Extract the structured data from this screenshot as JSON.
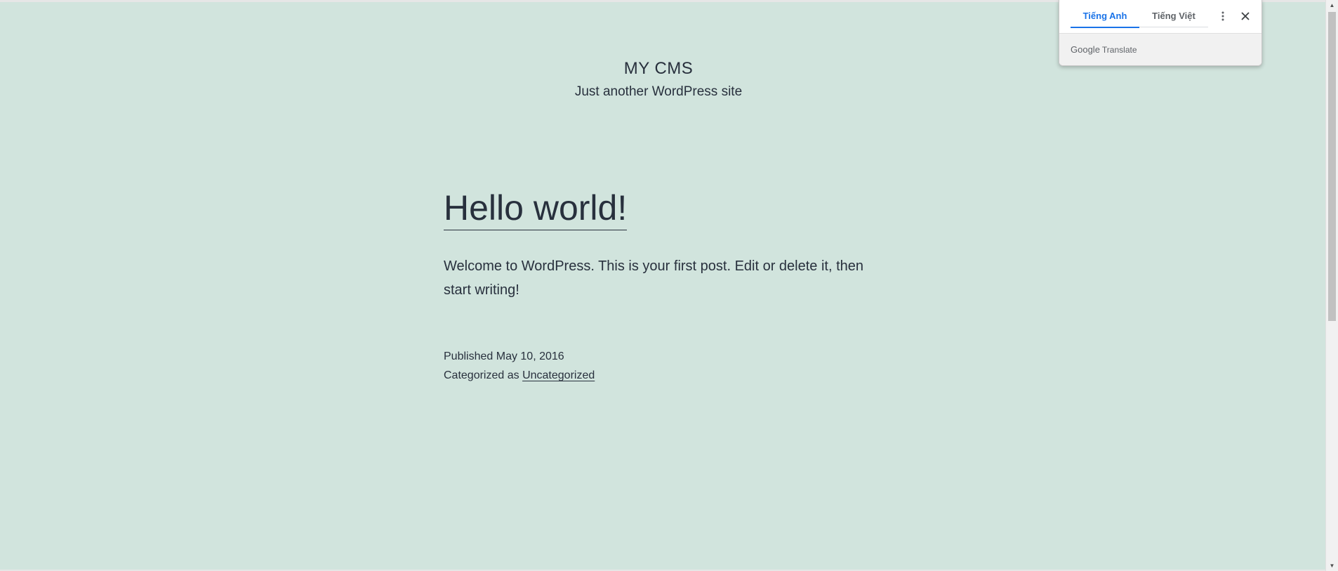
{
  "site": {
    "title": "MY CMS",
    "tagline": "Just another WordPress site"
  },
  "post": {
    "title": "Hello world!",
    "content": "Welcome to WordPress. This is your first post. Edit or delete it, then start writing!",
    "published_label": "Published",
    "published_date": "May 10, 2016",
    "categorized_label": "Categorized as",
    "category": "Uncategorized"
  },
  "translate_popup": {
    "tab_source": "Tiếng Anh",
    "tab_target": "Tiếng Việt",
    "active_tab": "Tiếng Anh",
    "brand_google": "Google",
    "brand_translate": "Translate",
    "menu_icon": "more-vert-icon",
    "close_icon": "close-icon"
  },
  "colors": {
    "page_background": "#d1e4dd",
    "text": "#28303d",
    "translate_accent": "#1a73e8"
  }
}
